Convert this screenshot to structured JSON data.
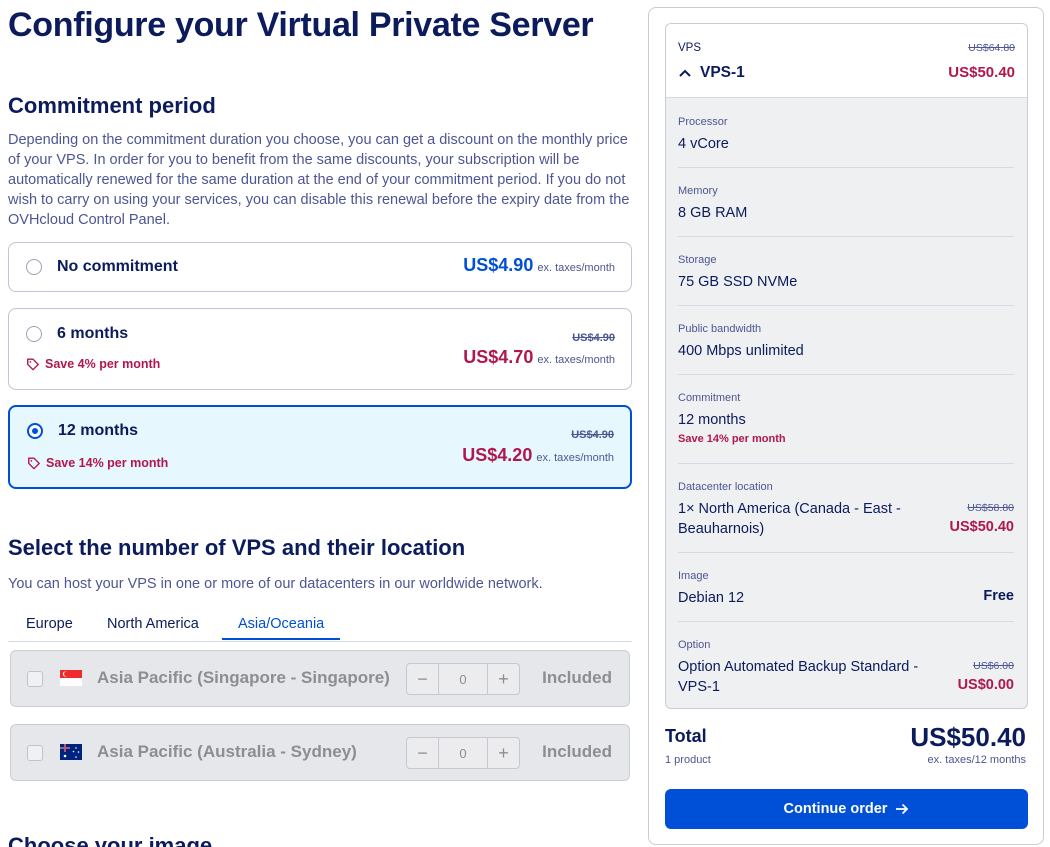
{
  "page_title": "Configure your Virtual Private Server",
  "commitment": {
    "title": "Commitment period",
    "description": "Depending on the commitment duration you choose, you can get a discount on the monthly price of your VPS. In order for you to benefit from the same discounts, your subscription will be automatically renewed for the same duration at the end of your commitment period. If you do not wish to carry on using your services, you can disable this renewal before the expiry date from the OVHcloud Control Panel.",
    "options": [
      {
        "label": "No commitment",
        "price": "US$4.90",
        "note": "ex. taxes/month",
        "old_price": "",
        "save": "",
        "selected": false
      },
      {
        "label": "6 months",
        "price": "US$4.70",
        "note": "ex. taxes/month",
        "old_price": "US$4.90",
        "save": "Save 4% per month",
        "selected": false
      },
      {
        "label": "12 months",
        "price": "US$4.20",
        "note": "ex. taxes/month",
        "old_price": "US$4.90",
        "save": "Save 14% per month",
        "selected": true
      }
    ]
  },
  "location": {
    "title": "Select the number of VPS and their location",
    "description": "You can host your VPS in one or more of our datacenters in our worldwide network.",
    "tabs": [
      "Europe",
      "North America",
      "Asia/Oceania"
    ],
    "active_tab": "Asia/Oceania",
    "datacenters": [
      {
        "name": "Asia Pacific (Singapore - Singapore)",
        "qty": "0",
        "status": "Included",
        "flag": "singapore-flag"
      },
      {
        "name": "Asia Pacific (Australia - Sydney)",
        "qty": "0",
        "status": "Included",
        "flag": "australia-flag"
      }
    ],
    "minus": "−",
    "plus": "+"
  },
  "next_section_title": "Choose your image",
  "summary": {
    "kicker": "VPS",
    "product": "VPS-1",
    "old_price": "US$64.80",
    "price": "US$50.40",
    "processor_label": "Processor",
    "processor_value": "4 vCore",
    "memory_label": "Memory",
    "memory_value": "8 GB RAM",
    "storage_label": "Storage",
    "storage_value": "75 GB SSD NVMe",
    "bandwidth_label": "Public bandwidth",
    "bandwidth_value": "400 Mbps unlimited",
    "commitment_label": "Commitment",
    "commitment_value": "12 months",
    "commitment_save": "Save 14% per month",
    "datacenter_label": "Datacenter location",
    "datacenter_value": "1× North America (Canada - East - Beauharnois)",
    "datacenter_old_price": "US$58.80",
    "datacenter_price": "US$50.40",
    "image_label": "Image",
    "image_value": "Debian 12",
    "image_price": "Free",
    "option_label": "Option",
    "option_value": "Option Automated Backup Standard - VPS-1",
    "option_old_price": "US$6.00",
    "option_price": "US$0.00",
    "total_label": "Total",
    "total_sub": "1 product",
    "total_price": "US$50.40",
    "total_note": "ex. taxes/12 months",
    "cta": "Continue order"
  },
  "colors": {
    "brand_blue": "#0050d7",
    "navy": "#0b1b5c",
    "discount_red": "#b0174f",
    "selected_bg": "#e6f8fd"
  }
}
